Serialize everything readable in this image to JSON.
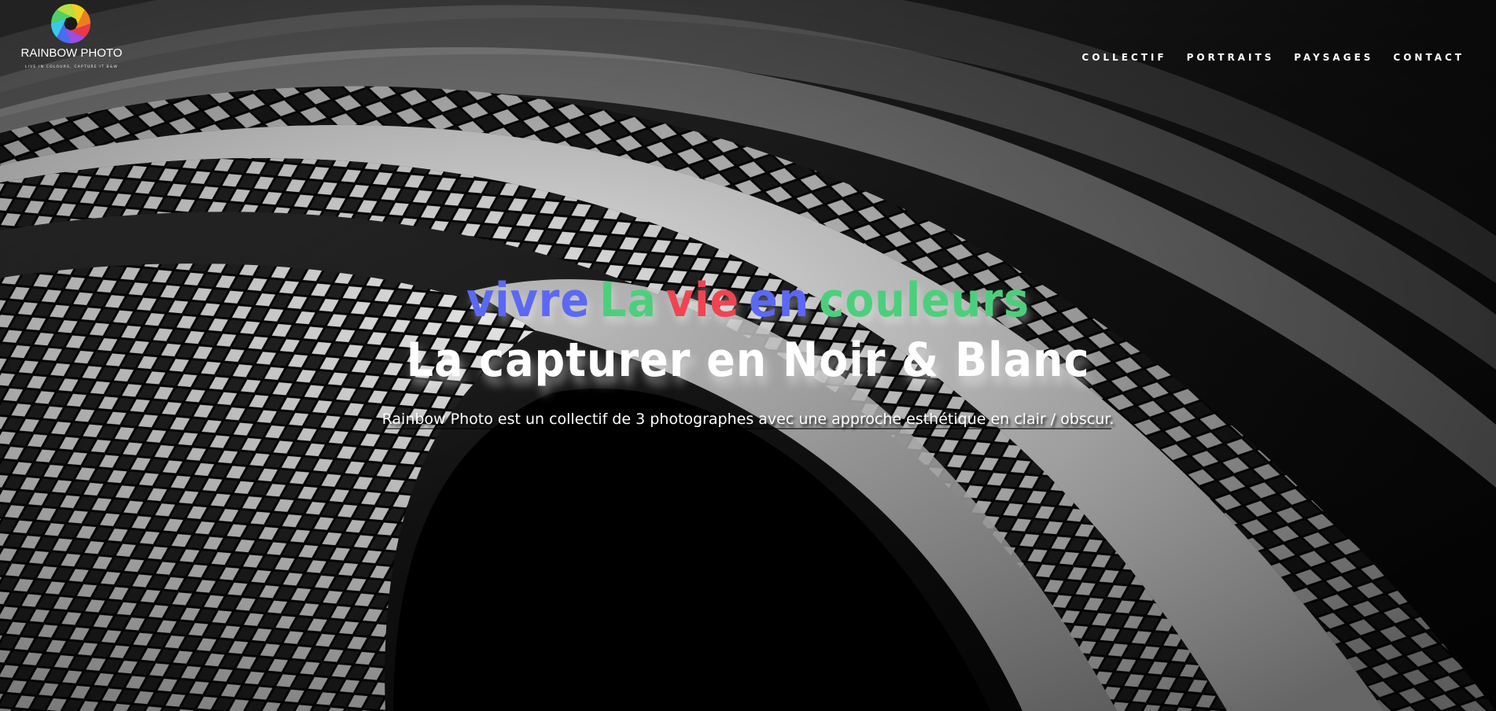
{
  "brand": {
    "name": "RAINBOW PHOTO",
    "tagline": "LIVE IN COLOURS, CAPTURE IT B&W",
    "logo_colors": [
      "#f0d020",
      "#f07c20",
      "#e8384a",
      "#9a4fe0",
      "#4a6cf0",
      "#3cc8e8",
      "#4cd06a",
      "#b8e040"
    ]
  },
  "nav": {
    "items": [
      {
        "label": "COLLECTIF"
      },
      {
        "label": "PORTRAITS"
      },
      {
        "label": "PAYSAGES"
      },
      {
        "label": "CONTACT"
      }
    ]
  },
  "hero": {
    "line1": [
      {
        "text": "vivre",
        "color": "#5b68f5"
      },
      {
        "text": "La",
        "color": "#4ccf7c"
      },
      {
        "text": "vie",
        "color": "#f04452"
      },
      {
        "text": "en",
        "color": "#5b68f5"
      },
      {
        "text": "couleurs",
        "color": "#4ccf7c"
      }
    ],
    "line2": "La capturer en Noir & Blanc",
    "description": "Rainbow Photo est un collectif de 3 photographes avec une approche esthétique en clair / obscur."
  }
}
